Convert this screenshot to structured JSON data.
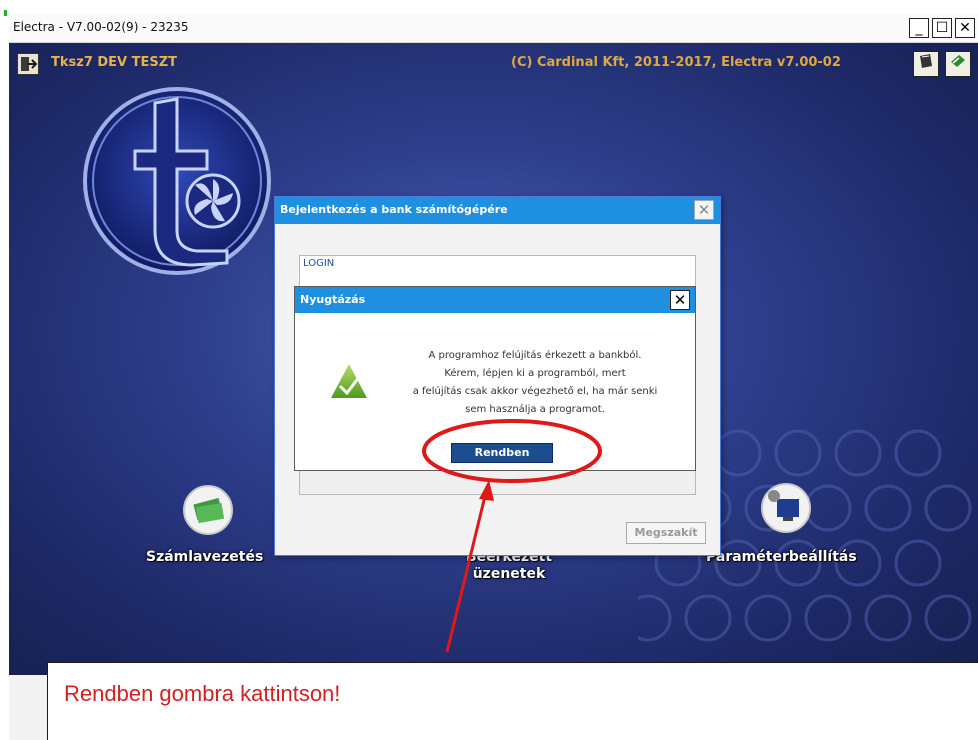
{
  "window": {
    "title": "Electra - V7.00-02(9) - 23235",
    "controls": [
      "_",
      "☐",
      "✕"
    ]
  },
  "app": {
    "title": "Tksz7 DEV TESZT",
    "copyright": "(C) Cardinal Kft, 2011-2017, Electra v7.00-02",
    "functions": [
      {
        "label": "Számlavezetés",
        "icon": "money-stack-icon"
      },
      {
        "label": "Beérkezett üzenetek",
        "icon": "envelope-icon"
      },
      {
        "label": "Paraméterbeállítás",
        "icon": "computer-settings-icon"
      }
    ]
  },
  "login_dialog": {
    "title": "Bejelentkezés a bank számítógépére",
    "close_glyph": "✕",
    "group_label": "LOGIN",
    "cancel_label": "Megszakít"
  },
  "confirm_dialog": {
    "title": "Nyugtázás",
    "close_glyph": "✕",
    "message_lines": [
      "A programhoz felújítás érkezett a bankból.",
      "Kérem, lépjen ki a programból, mert",
      "a felújítás csak akkor végezhető el, ha már senki",
      "sem használja a programot."
    ],
    "ok_label": "Rendben"
  },
  "annotation": {
    "instruction": "Rendben gombra kattintson!",
    "color": "#d42020"
  },
  "colors": {
    "dialog_header": "#1f8fe0",
    "ok_button": "#1d4d8f",
    "header_text": "#e0a83e"
  }
}
